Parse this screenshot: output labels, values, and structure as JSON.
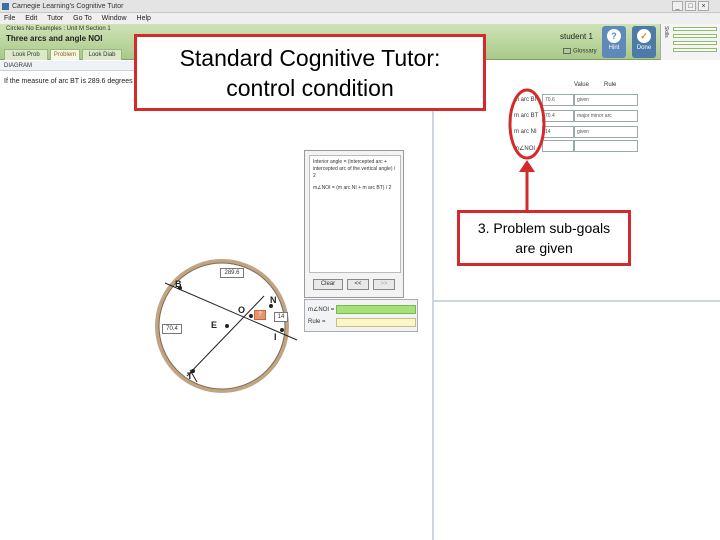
{
  "window": {
    "title": "Carnegie Learning's Cognitive Tutor",
    "controls": {
      "minimize": "_",
      "maximize": "□",
      "close": "×"
    }
  },
  "menu": [
    "File",
    "Edit",
    "Tutor",
    "Go To",
    "Window",
    "Help"
  ],
  "header": {
    "unit_label": "Circles No Examples : Unit M Section 1",
    "problem_title": "Three arcs and angle NOI",
    "tabs": [
      "Look Prob",
      "Problem",
      "Look Diab"
    ],
    "student": "student 1",
    "glossary_label": "Glossary",
    "hint_button": "Hint",
    "done_button": "Done",
    "skills_label": "Skills"
  },
  "diagram_panel": {
    "header": "DIAGRAM",
    "problem_statement": "If the measure of arc BT is 289.6 degrees a"
  },
  "table": {
    "col_value": "Value",
    "col_rule": "Rule",
    "rows": [
      {
        "label": "m arc BN",
        "value": "70.6",
        "rule": "given"
      },
      {
        "label": "m arc BT",
        "value": "70.4",
        "rule": "major minor arc"
      },
      {
        "label": "m arc NI",
        "value": "14",
        "rule": "given"
      },
      {
        "label": "m∠NOI",
        "value": "",
        "rule": ""
      }
    ]
  },
  "hint_panel": {
    "text_1": "Interior angle = (intercepted arc + intercepted arc of the vertical angle) / 2",
    "text_2": "m∠NOI = (m arc NI + m arc BT) / 2",
    "clear_button": "Clear",
    "prev_button": "<<",
    "next_button": ">>"
  },
  "answer_panel": {
    "angle_label": "m∠NOI =",
    "rule_label": "Rule ="
  },
  "diagram": {
    "labels": {
      "B": "B",
      "N": "N",
      "O": "O",
      "E": "E",
      "T": "T",
      "I": "I"
    },
    "measures": {
      "top": "289.6",
      "left": "70.4",
      "right": "14",
      "unknown": "?"
    }
  },
  "callouts": {
    "main_line1": "Standard Cognitive Tutor:",
    "main_line2": "control condition",
    "subgoals_line1": "3. Problem sub-goals",
    "subgoals_line2": "are given"
  },
  "colors": {
    "accent_red": "#d52a2a",
    "tutor_green": "#a9c98a",
    "answer_green": "#a7e07a",
    "answer_yellow": "#fbf7c8",
    "circle_tan": "#c2a480"
  }
}
